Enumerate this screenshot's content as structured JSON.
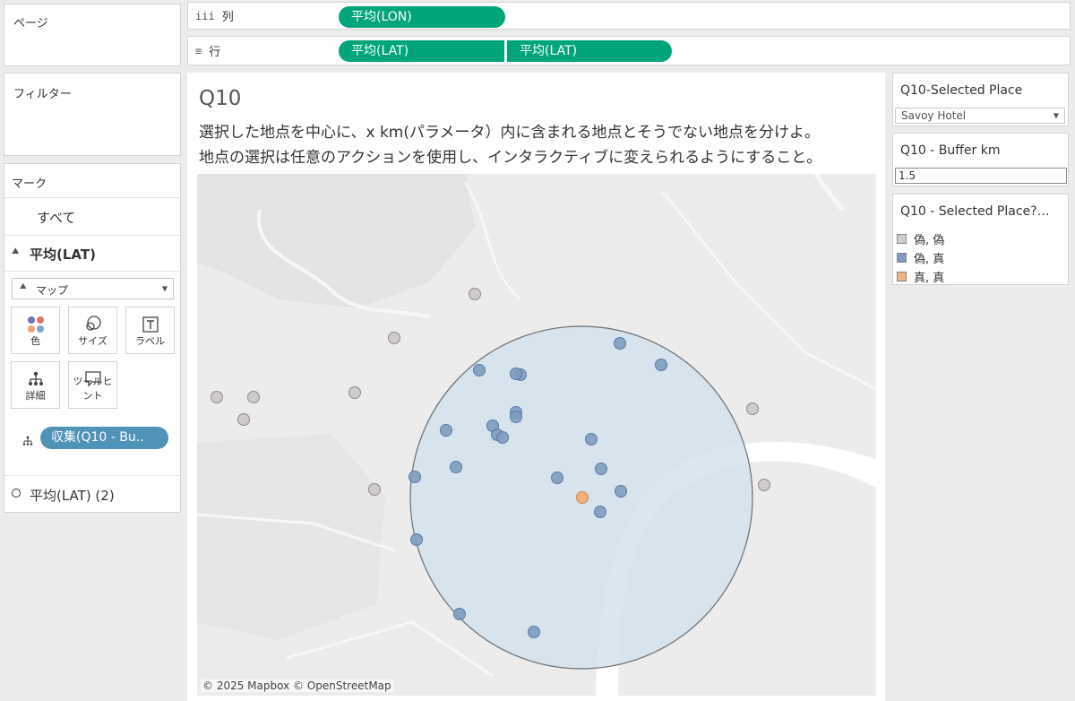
{
  "left": {
    "pages_title": "ページ",
    "filters_title": "フィルター",
    "marks": {
      "title": "マーク",
      "all_label": "すべて",
      "active_layer": "平均(LAT)",
      "mark_type": "マップ",
      "buttons": [
        "色",
        "サイズ",
        "ラベル",
        "詳細",
        "ツールヒント"
      ],
      "detail_pill": "収集(Q10 - Bu..",
      "second_layer": "平均(LAT) (2)"
    }
  },
  "shelves": {
    "columns_label": "列",
    "columns_pill": "平均(LON)",
    "rows_label": "行",
    "rows_pills": [
      "平均(LAT)",
      "平均(LAT)"
    ]
  },
  "sheet": {
    "title": "Q10",
    "desc_line1": "選択した地点を中心に、x km(パラメータ）内に含まれる地点とそうでない地点を分けよ。",
    "desc_line2": "地点の選択は任意のアクションを使用し、インタラクティブに変えられるようにすること。",
    "attribution": "© 2025 Mapbox © OpenStreetMap"
  },
  "right": {
    "selected_place_title": "Q10-Selected Place",
    "selected_place_value": "Savoy Hotel",
    "buffer_title": "Q10 - Buffer km",
    "buffer_value": "1.5",
    "legend_title": "Q10 - Selected Place?…",
    "legend": [
      {
        "label": "偽, 偽",
        "color": "#cfcbcb"
      },
      {
        "label": "偽, 真",
        "color": "#7f9cc0"
      },
      {
        "label": "真, 真",
        "color": "#f2b07a"
      }
    ]
  },
  "map_points": {
    "false_false": 10,
    "false_true": 25,
    "true_true": 1
  }
}
